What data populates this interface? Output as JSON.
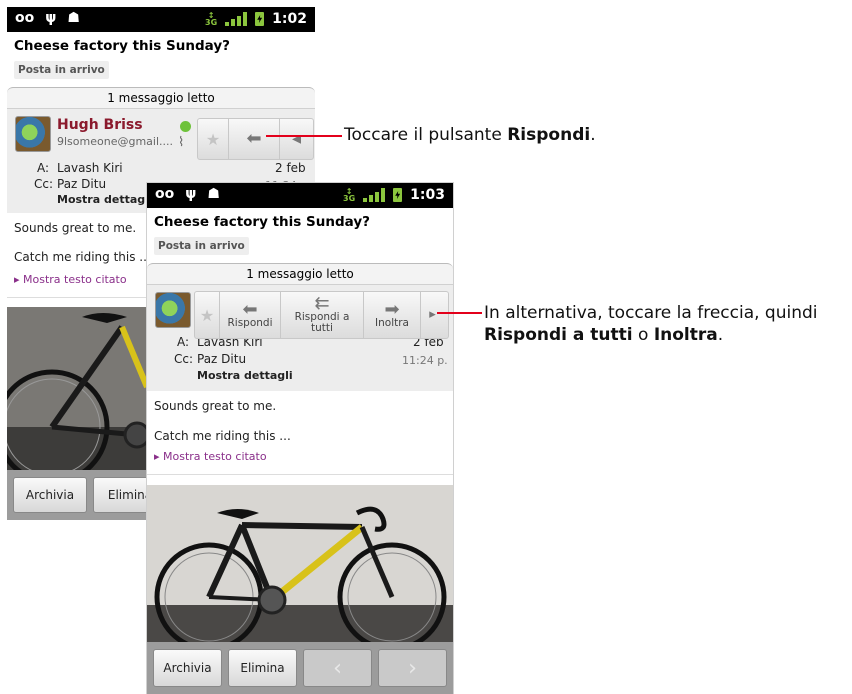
{
  "phone1": {
    "status": {
      "time": "1:02",
      "left_icons": [
        "voicemail-icon",
        "usb-icon",
        "android-icon"
      ],
      "network": "3G"
    },
    "subject": "Cheese factory this Sunday?",
    "label": "Posta in arrivo",
    "read_count": "1 messaggio letto",
    "sender": {
      "name": "Hugh Briss",
      "email": "9lsomeone@gmail...."
    },
    "to_label": "A:",
    "to_value": "Lavash Kiri",
    "date": "2 feb",
    "cc_label": "Cc:",
    "cc_value": "Paz Ditu",
    "time_partial": "11:24 p.",
    "show_details": "Mostra dettagli",
    "body_line1": "Sounds great to me.",
    "body_line2": "Catch me riding this ...",
    "quoted_link": "▸ Mostra testo citato",
    "bottom": {
      "archive": "Archivia",
      "delete": "Elimina"
    }
  },
  "phone2": {
    "status": {
      "time": "1:03",
      "left_icons": [
        "voicemail-icon",
        "usb-icon",
        "android-icon"
      ],
      "network": "3G"
    },
    "subject": "Cheese factory this Sunday?",
    "label": "Posta in arrivo",
    "read_count": "1 messaggio letto",
    "actions": {
      "reply": "Rispondi",
      "reply_all": "Rispondi a tutti",
      "forward": "Inoltra"
    },
    "to_label": "A:",
    "to_value": "Lavash Kiri",
    "date": "2 feb",
    "cc_label": "Cc:",
    "cc_value": "Paz Ditu",
    "time": "11:24 p.",
    "show_details": "Mostra dettagli",
    "body_line1": "Sounds great to me.",
    "body_line2": "Catch me riding this ...",
    "quoted_link": "▸ Mostra testo citato",
    "bottom": {
      "archive": "Archivia",
      "delete": "Elimina",
      "prev": "‹",
      "next": "›"
    }
  },
  "callouts": {
    "first_prefix": "Toccare il pulsante ",
    "first_bold": "Rispondi",
    "first_suffix": ".",
    "second_line1": "In alternativa, toccare la freccia, quindi",
    "second_bold1": "Rispondi a tutti",
    "second_mid": " o ",
    "second_bold2": "Inoltra",
    "second_suffix": "."
  },
  "colors": {
    "callout_line": "#e3001b",
    "sender_name": "#8b1a2d",
    "link": "#8a2f8a",
    "presence": "#6ec23a"
  }
}
